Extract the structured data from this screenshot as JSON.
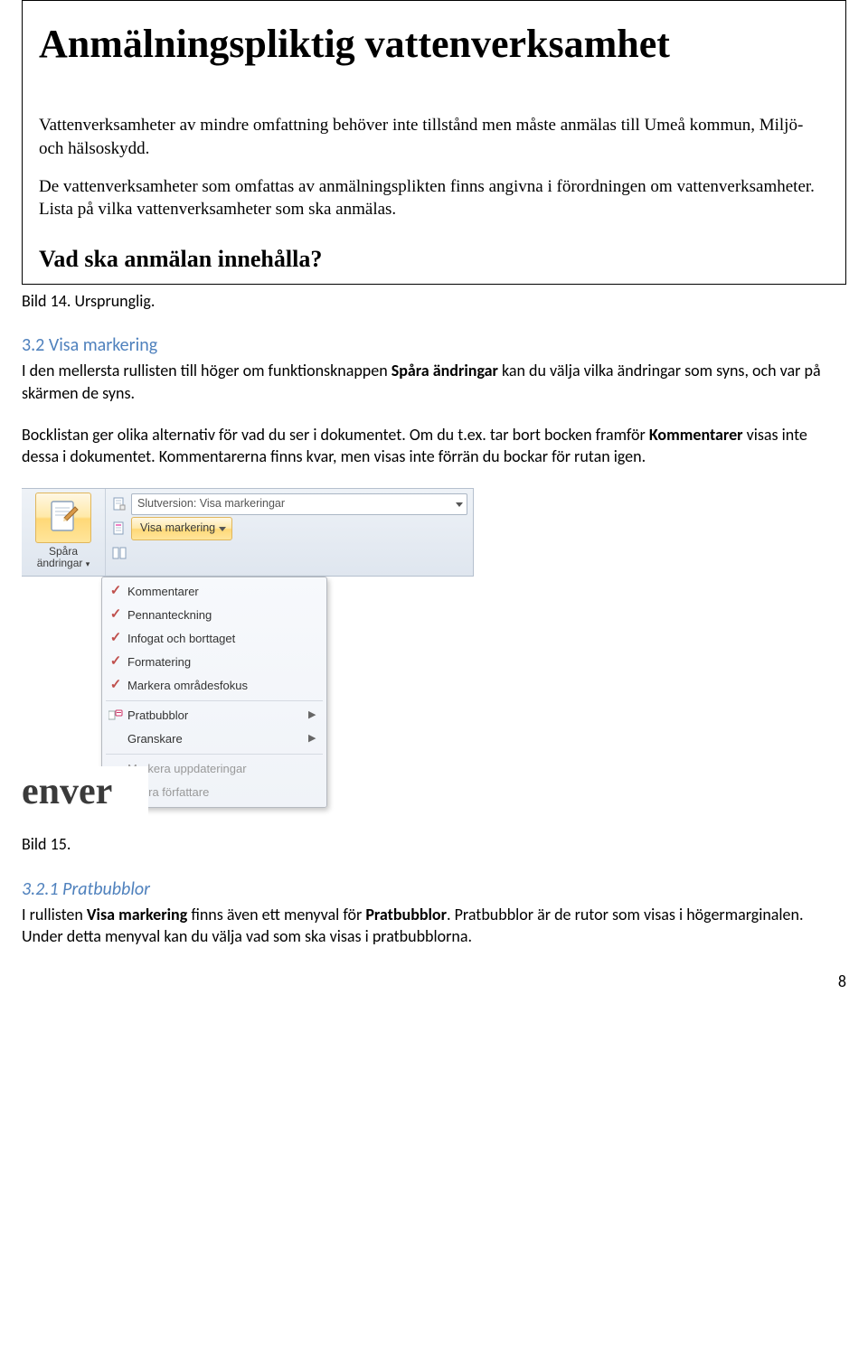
{
  "fig1": {
    "title": "Anmälningspliktig vattenverksamhet",
    "p1": "Vattenverksamheter av mindre omfattning behöver inte tillstånd men måste anmälas till Umeå kommun, Miljö- och hälsoskydd.",
    "p2": "De vattenverksamheter som omfattas av anmälningsplikten finns angivna i förordningen om vattenverksamheter. Lista på vilka vattenverksamheter som ska anmälas.",
    "h2": "Vad ska anmälan innehålla?"
  },
  "caption1": "Bild 14. Ursprunglig.",
  "sec32": {
    "head": "3.2 Visa markering",
    "p1_a": "I den mellersta rullisten till höger om funktionsknappen ",
    "p1_b": "Spåra ändringar",
    "p1_c": " kan du välja vilka ändringar som syns, och var på skärmen de syns.",
    "p2_a": "Bocklistan ger olika alternativ för vad du ser i dokumentet. Om du t.ex. tar bort bocken framför ",
    "p2_b": "Kommentarer",
    "p2_c": " visas inte dessa i dokumentet. Kommentarerna finns kvar, men visas inte förrän du bockar för rutan igen."
  },
  "ribbon": {
    "track_label_1": "Spåra",
    "track_label_2": "ändringar",
    "combo_text": "Slutversion: Visa markeringar",
    "vm_label": "Visa markering",
    "items": [
      {
        "check": "✓",
        "label": "Kommentarer"
      },
      {
        "check": "✓",
        "label": "Pennanteckning"
      },
      {
        "check": "✓",
        "label": "Infogat och borttaget"
      },
      {
        "check": "✓",
        "label": "Formatering"
      },
      {
        "check": "✓",
        "label": "Markera områdesfokus"
      },
      {
        "icon": "balloon",
        "label": "Pratbubblor",
        "sub": "▶"
      },
      {
        "label": "Granskare",
        "sub": "▶"
      },
      {
        "label": "Markera uppdateringar",
        "dim": true
      },
      {
        "label": "Andra författare",
        "dim": true
      }
    ],
    "cut_text": "enver"
  },
  "caption2": "Bild 15.",
  "sec321": {
    "head": "3.2.1 Pratbubblor",
    "p1_a": "I rullisten ",
    "p1_b": "Visa markering",
    "p1_c": " finns även ett menyval för ",
    "p1_d": "Pratbubblor",
    "p1_e": ". Pratbubblor är de rutor som visas i högermarginalen. Under detta menyval kan du välja vad som ska visas i pratbubblorna."
  },
  "page_number": "8"
}
